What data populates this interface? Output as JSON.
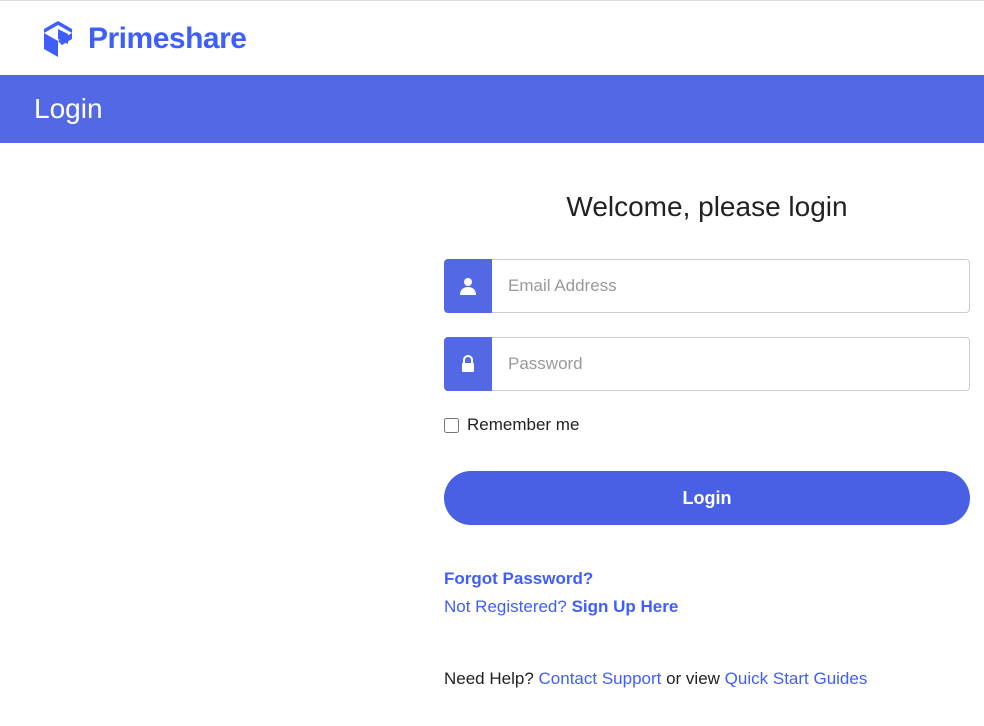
{
  "brand": {
    "name": "Primeshare"
  },
  "titleBar": {
    "text": "Login"
  },
  "form": {
    "heading": "Welcome, please login",
    "emailPlaceholder": "Email Address",
    "passwordPlaceholder": "Password",
    "rememberLabel": "Remember me",
    "loginButton": "Login"
  },
  "links": {
    "forgot": "Forgot Password?",
    "notRegistered": "Not Registered? ",
    "signUp": "Sign Up Here",
    "helpPrefix": "Need Help? ",
    "contactSupport": "Contact Support",
    "helpMiddle": " or view ",
    "quickStart": "Quick Start Guides"
  }
}
